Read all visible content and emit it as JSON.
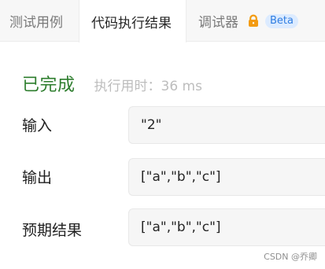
{
  "tabs": {
    "test_cases": "测试用例",
    "run_results": "代码执行结果",
    "debugger": "调试器",
    "beta_badge": "Beta"
  },
  "status": {
    "label": "已完成",
    "runtime": "执行用时：36 ms",
    "color": "#2d7d2d"
  },
  "fields": {
    "input_label": "输入",
    "input_value": "\"2\"",
    "output_label": "输出",
    "output_value": "[\"a\",\"b\",\"c\"]",
    "expected_label": "预期结果",
    "expected_value": "[\"a\",\"b\",\"c\"]"
  },
  "watermark": "CSDN @乔卿",
  "icons": {
    "lock": "lock-icon"
  }
}
